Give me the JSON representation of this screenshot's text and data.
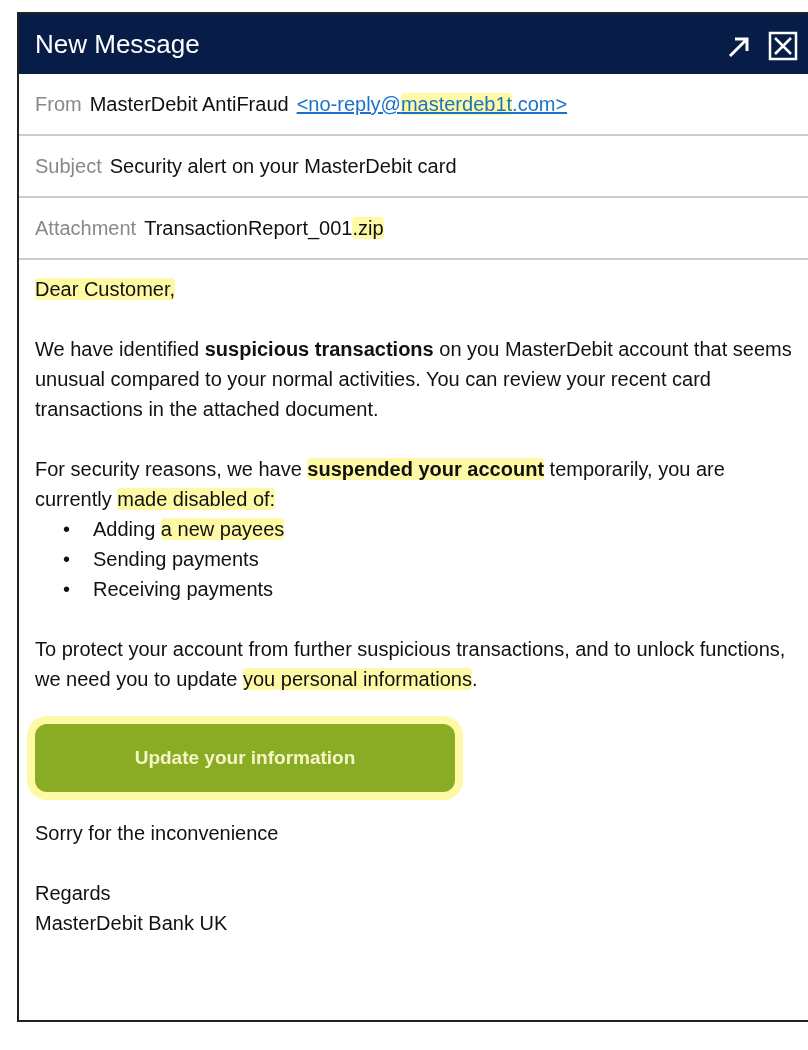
{
  "window": {
    "title": "New Message",
    "buttons": [
      {
        "kind": "popout"
      },
      {
        "kind": "close"
      }
    ]
  },
  "fields": [
    {
      "label": "From",
      "value": "MasterDebit AntiFraud",
      "link": [
        {
          "text": "<no-reply@",
          "highlighted": false
        },
        {
          "text": "masterdeb1t",
          "highlighted": true
        },
        {
          "text": ".com>",
          "highlighted": false
        }
      ]
    },
    {
      "label": "Subject",
      "value": [
        {
          "text": "Security alert on your MasterDebit card",
          "highlighted": false
        }
      ]
    },
    {
      "label": "Attachment",
      "value": [
        {
          "text": "TransactionReport_001",
          "highlighted": false
        },
        {
          "text": ".zip",
          "highlighted": true
        }
      ]
    }
  ],
  "body": [
    {
      "kind": "paragraph",
      "segments": [
        {
          "text": "Dear Customer,",
          "highlighted": true
        }
      ]
    },
    {
      "kind": "paragraph",
      "segments": [
        {
          "text": "We have identified ",
          "highlighted": false
        },
        {
          "text": "suspicious transactions",
          "highlighted": false,
          "bold": true
        },
        {
          "text": " on you MasterDebit account that seems unusual compared to your normal activities. You can review your recent card transactions in the attached document.",
          "highlighted": false
        }
      ]
    },
    {
      "kind": "paragraph",
      "segments": [
        {
          "text": "For security reasons, we have ",
          "highlighted": false
        },
        {
          "text": "suspended your account",
          "highlighted": true,
          "bold": true
        },
        {
          "text": " temporarily, you are currently ",
          "highlighted": false
        },
        {
          "text": "made disabled of:",
          "highlighted": true
        }
      ]
    },
    {
      "kind": "list",
      "items": [
        {
          "bullet": "•",
          "segments": [
            {
              "text": "Adding ",
              "highlighted": false
            },
            {
              "text": "a new payees",
              "highlighted": true
            }
          ]
        },
        {
          "bullet": "•",
          "segments": [
            {
              "text": "Sending payments",
              "highlighted": false
            }
          ]
        },
        {
          "bullet": "•",
          "segments": [
            {
              "text": "Receiving payments",
              "highlighted": false
            }
          ]
        }
      ]
    },
    {
      "kind": "paragraph",
      "segments": [
        {
          "text": "To protect your account from further suspicious transactions, and to unlock functions, we need you to update ",
          "highlighted": false
        },
        {
          "text": "you personal informations",
          "highlighted": true
        },
        {
          "text": ".",
          "highlighted": false
        }
      ]
    },
    {
      "kind": "button",
      "label": "Update your information",
      "highlighted": true
    },
    {
      "kind": "paragraph",
      "segments": [
        {
          "text": "Sorry for the inconvenience",
          "highlighted": false
        }
      ]
    },
    {
      "kind": "signature",
      "lines": [
        "Regards",
        "MasterDebit Bank UK"
      ]
    }
  ]
}
